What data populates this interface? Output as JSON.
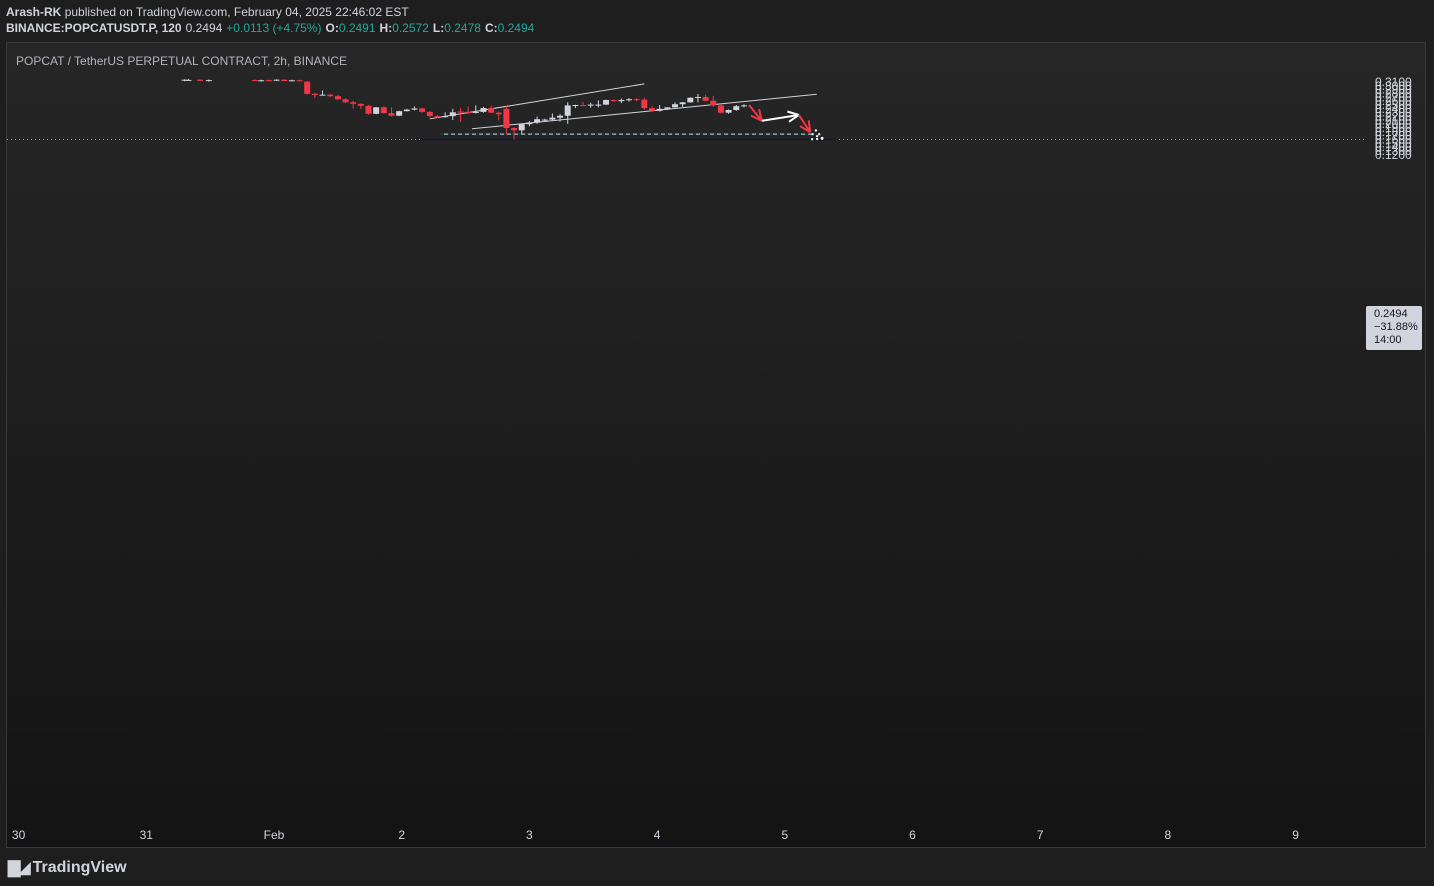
{
  "header": {
    "author": "Arash-RK",
    "published_text": "published on TradingView.com, February 04, 2025 22:46:02 EST",
    "symbol": "BINANCE:POPCATUSDT.P, 120",
    "last": "0.2494",
    "change": "+0.0113 (+4.75%)",
    "o_label": "O:",
    "o": "0.2491",
    "h_label": "H:",
    "h": "0.2572",
    "l_label": "L:",
    "l": "0.2478",
    "c_label": "C:",
    "c": "0.2494"
  },
  "symbol_label": "POPCAT / TetherUS PERPETUAL CONTRACT, 2h, BINANCE",
  "price_tag": {
    "price": "0.2494",
    "change_pct": "−31.88%",
    "countdown": "14:00"
  },
  "footer": {
    "brand": "TradingView",
    "logo_icon": "tradingview-logo-icon"
  },
  "colors": {
    "up": "#d1d4dc",
    "down": "#f23645",
    "zone": "#123a3f",
    "zone2": "#151b32",
    "arrow_red": "#f23645",
    "arrow_white": "#ffffff"
  },
  "chart_data": {
    "type": "candlestick",
    "title": "POPCAT / TetherUS PERPETUAL CONTRACT, 2h, BINANCE",
    "y_ticks": [
      "0.3100",
      "0.3000",
      "0.2900",
      "0.2800",
      "0.2700",
      "0.2600",
      "0.2500",
      "0.2400",
      "0.2300",
      "0.2200",
      "0.2100",
      "0.2000",
      "0.1900",
      "0.1800",
      "0.1700",
      "0.1600",
      "0.1500",
      "0.1400",
      "0.1300",
      "0.1200"
    ],
    "x_ticks": [
      {
        "label": "30",
        "t": -2
      },
      {
        "label": "31",
        "t": -1
      },
      {
        "label": "Feb",
        "t": 0
      },
      {
        "label": "2",
        "t": 1
      },
      {
        "label": "3",
        "t": 2
      },
      {
        "label": "4",
        "t": 3
      },
      {
        "label": "5",
        "t": 4
      },
      {
        "label": "6",
        "t": 5
      },
      {
        "label": "7",
        "t": 6
      },
      {
        "label": "8",
        "t": 7
      },
      {
        "label": "9",
        "t": 8
      }
    ],
    "ylim": [
      0.115,
      0.3145
    ],
    "grid": false,
    "candles": [
      {
        "t": -0.7,
        "o": 0.314,
        "h": 0.317,
        "l": 0.312,
        "c": 0.316
      },
      {
        "t": -0.67,
        "o": 0.315,
        "h": 0.318,
        "l": 0.313,
        "c": 0.3155
      },
      {
        "t": -0.58,
        "o": 0.316,
        "h": 0.317,
        "l": 0.312,
        "c": 0.313
      },
      {
        "t": -0.51,
        "o": 0.313,
        "h": 0.3165,
        "l": 0.311,
        "c": 0.315
      },
      {
        "t": -0.15,
        "o": 0.315,
        "h": 0.317,
        "l": 0.312,
        "c": 0.313
      },
      {
        "t": -0.1,
        "o": 0.313,
        "h": 0.316,
        "l": 0.311,
        "c": 0.3145
      },
      {
        "t": -0.04,
        "o": 0.315,
        "h": 0.316,
        "l": 0.312,
        "c": 0.312
      },
      {
        "t": 0.02,
        "o": 0.314,
        "h": 0.317,
        "l": 0.3125,
        "c": 0.316
      },
      {
        "t": 0.08,
        "o": 0.316,
        "h": 0.317,
        "l": 0.312,
        "c": 0.3125
      },
      {
        "t": 0.14,
        "o": 0.313,
        "h": 0.316,
        "l": 0.312,
        "c": 0.3145
      },
      {
        "t": 0.2,
        "o": 0.3145,
        "h": 0.316,
        "l": 0.311,
        "c": 0.312
      },
      {
        "t": 0.26,
        "o": 0.311,
        "h": 0.312,
        "l": 0.277,
        "c": 0.279
      },
      {
        "t": 0.32,
        "o": 0.279,
        "h": 0.282,
        "l": 0.268,
        "c": 0.276
      },
      {
        "t": 0.38,
        "o": 0.276,
        "h": 0.288,
        "l": 0.275,
        "c": 0.277
      },
      {
        "t": 0.44,
        "o": 0.277,
        "h": 0.279,
        "l": 0.27,
        "c": 0.273
      },
      {
        "t": 0.5,
        "o": 0.273,
        "h": 0.276,
        "l": 0.263,
        "c": 0.265
      },
      {
        "t": 0.56,
        "o": 0.265,
        "h": 0.268,
        "l": 0.255,
        "c": 0.257
      },
      {
        "t": 0.62,
        "o": 0.257,
        "h": 0.261,
        "l": 0.241,
        "c": 0.253
      },
      {
        "t": 0.68,
        "o": 0.253,
        "h": 0.254,
        "l": 0.24,
        "c": 0.248
      },
      {
        "t": 0.74,
        "o": 0.248,
        "h": 0.25,
        "l": 0.225,
        "c": 0.227
      },
      {
        "t": 0.8,
        "o": 0.227,
        "h": 0.245,
        "l": 0.226,
        "c": 0.244
      },
      {
        "t": 0.86,
        "o": 0.244,
        "h": 0.246,
        "l": 0.227,
        "c": 0.229
      },
      {
        "t": 0.92,
        "o": 0.229,
        "h": 0.244,
        "l": 0.22,
        "c": 0.222
      },
      {
        "t": 0.98,
        "o": 0.222,
        "h": 0.235,
        "l": 0.221,
        "c": 0.234
      },
      {
        "t": 1.04,
        "o": 0.234,
        "h": 0.24,
        "l": 0.233,
        "c": 0.238
      },
      {
        "t": 1.1,
        "o": 0.238,
        "h": 0.246,
        "l": 0.236,
        "c": 0.241
      },
      {
        "t": 1.16,
        "o": 0.241,
        "h": 0.243,
        "l": 0.23,
        "c": 0.232
      },
      {
        "t": 1.22,
        "o": 0.232,
        "h": 0.234,
        "l": 0.218,
        "c": 0.221
      },
      {
        "t": 1.28,
        "o": 0.221,
        "h": 0.224,
        "l": 0.216,
        "c": 0.219
      },
      {
        "t": 1.34,
        "o": 0.219,
        "h": 0.231,
        "l": 0.217,
        "c": 0.221
      },
      {
        "t": 1.4,
        "o": 0.221,
        "h": 0.24,
        "l": 0.211,
        "c": 0.231
      },
      {
        "t": 1.46,
        "o": 0.233,
        "h": 0.242,
        "l": 0.206,
        "c": 0.232
      },
      {
        "t": 1.52,
        "o": 0.232,
        "h": 0.246,
        "l": 0.226,
        "c": 0.23
      },
      {
        "t": 1.58,
        "o": 0.23,
        "h": 0.249,
        "l": 0.228,
        "c": 0.232
      },
      {
        "t": 1.64,
        "o": 0.232,
        "h": 0.245,
        "l": 0.23,
        "c": 0.242
      },
      {
        "t": 1.7,
        "o": 0.242,
        "h": 0.248,
        "l": 0.229,
        "c": 0.23
      },
      {
        "t": 1.76,
        "o": 0.23,
        "h": 0.233,
        "l": 0.21,
        "c": 0.226
      },
      {
        "t": 1.82,
        "o": 0.24,
        "h": 0.247,
        "l": 0.174,
        "c": 0.19
      },
      {
        "t": 1.88,
        "o": 0.19,
        "h": 0.192,
        "l": 0.16,
        "c": 0.184
      },
      {
        "t": 1.94,
        "o": 0.184,
        "h": 0.2,
        "l": 0.175,
        "c": 0.2
      },
      {
        "t": 2.0,
        "o": 0.2,
        "h": 0.208,
        "l": 0.195,
        "c": 0.204
      },
      {
        "t": 2.06,
        "o": 0.204,
        "h": 0.22,
        "l": 0.201,
        "c": 0.213
      },
      {
        "t": 2.12,
        "o": 0.211,
        "h": 0.214,
        "l": 0.207,
        "c": 0.212
      },
      {
        "t": 2.18,
        "o": 0.212,
        "h": 0.228,
        "l": 0.21,
        "c": 0.217
      },
      {
        "t": 2.24,
        "o": 0.217,
        "h": 0.226,
        "l": 0.207,
        "c": 0.222
      },
      {
        "t": 2.3,
        "o": 0.222,
        "h": 0.257,
        "l": 0.201,
        "c": 0.249
      },
      {
        "t": 2.36,
        "o": 0.249,
        "h": 0.251,
        "l": 0.242,
        "c": 0.25
      },
      {
        "t": 2.42,
        "o": 0.25,
        "h": 0.258,
        "l": 0.248,
        "c": 0.249
      },
      {
        "t": 2.48,
        "o": 0.249,
        "h": 0.256,
        "l": 0.243,
        "c": 0.251
      },
      {
        "t": 2.54,
        "o": 0.251,
        "h": 0.262,
        "l": 0.244,
        "c": 0.251
      },
      {
        "t": 2.6,
        "o": 0.251,
        "h": 0.264,
        "l": 0.25,
        "c": 0.263
      },
      {
        "t": 2.66,
        "o": 0.263,
        "h": 0.264,
        "l": 0.259,
        "c": 0.26
      },
      {
        "t": 2.72,
        "o": 0.26,
        "h": 0.267,
        "l": 0.255,
        "c": 0.263
      },
      {
        "t": 2.78,
        "o": 0.263,
        "h": 0.268,
        "l": 0.259,
        "c": 0.265
      },
      {
        "t": 2.84,
        "o": 0.265,
        "h": 0.268,
        "l": 0.26,
        "c": 0.264
      },
      {
        "t": 2.9,
        "o": 0.264,
        "h": 0.269,
        "l": 0.238,
        "c": 0.242
      },
      {
        "t": 2.96,
        "o": 0.242,
        "h": 0.247,
        "l": 0.234,
        "c": 0.235
      },
      {
        "t": 3.02,
        "o": 0.235,
        "h": 0.25,
        "l": 0.233,
        "c": 0.24
      },
      {
        "t": 3.08,
        "o": 0.24,
        "h": 0.244,
        "l": 0.237,
        "c": 0.244
      },
      {
        "t": 3.14,
        "o": 0.244,
        "h": 0.257,
        "l": 0.243,
        "c": 0.252
      },
      {
        "t": 3.2,
        "o": 0.252,
        "h": 0.258,
        "l": 0.245,
        "c": 0.257
      },
      {
        "t": 3.26,
        "o": 0.257,
        "h": 0.27,
        "l": 0.256,
        "c": 0.269
      },
      {
        "t": 3.32,
        "o": 0.269,
        "h": 0.279,
        "l": 0.257,
        "c": 0.271
      },
      {
        "t": 3.38,
        "o": 0.271,
        "h": 0.277,
        "l": 0.26,
        "c": 0.261
      },
      {
        "t": 3.44,
        "o": 0.261,
        "h": 0.274,
        "l": 0.245,
        "c": 0.249
      },
      {
        "t": 3.5,
        "o": 0.249,
        "h": 0.252,
        "l": 0.228,
        "c": 0.23
      },
      {
        "t": 3.56,
        "o": 0.23,
        "h": 0.238,
        "l": 0.227,
        "c": 0.237
      },
      {
        "t": 3.62,
        "o": 0.237,
        "h": 0.25,
        "l": 0.235,
        "c": 0.247
      },
      {
        "t": 3.68,
        "o": 0.247,
        "h": 0.252,
        "l": 0.244,
        "c": 0.249
      }
    ],
    "trendlines": [
      {
        "from": [
          1.22,
          0.214
        ],
        "to": [
          2.9,
          0.305
        ]
      },
      {
        "from": [
          1.55,
          0.188
        ],
        "to": [
          4.25,
          0.278
        ]
      }
    ],
    "zones": [
      {
        "t_from": 1.3,
        "t_to": 4.24,
        "y_from": 0.172,
        "y_to": 0.177,
        "mid_dashed": 0.1742
      },
      {
        "t_from": 1.15,
        "t_to": 4.4,
        "y_from": 0.158,
        "y_to": 0.162
      }
    ],
    "horizontal_dotted": 0.16,
    "projection_arrows": [
      {
        "color": "red",
        "points": [
          [
            3.72,
            0.25
          ],
          [
            3.82,
            0.209
          ]
        ]
      },
      {
        "color": "white",
        "points": [
          [
            3.82,
            0.209
          ],
          [
            4.11,
            0.224
          ]
        ]
      },
      {
        "color": "red",
        "points": [
          [
            4.11,
            0.224
          ],
          [
            4.2,
            0.179
          ]
        ]
      },
      {
        "color": "white-dotted",
        "points": [
          [
            4.21,
            0.175
          ],
          [
            4.3,
            0.162
          ]
        ]
      }
    ]
  }
}
